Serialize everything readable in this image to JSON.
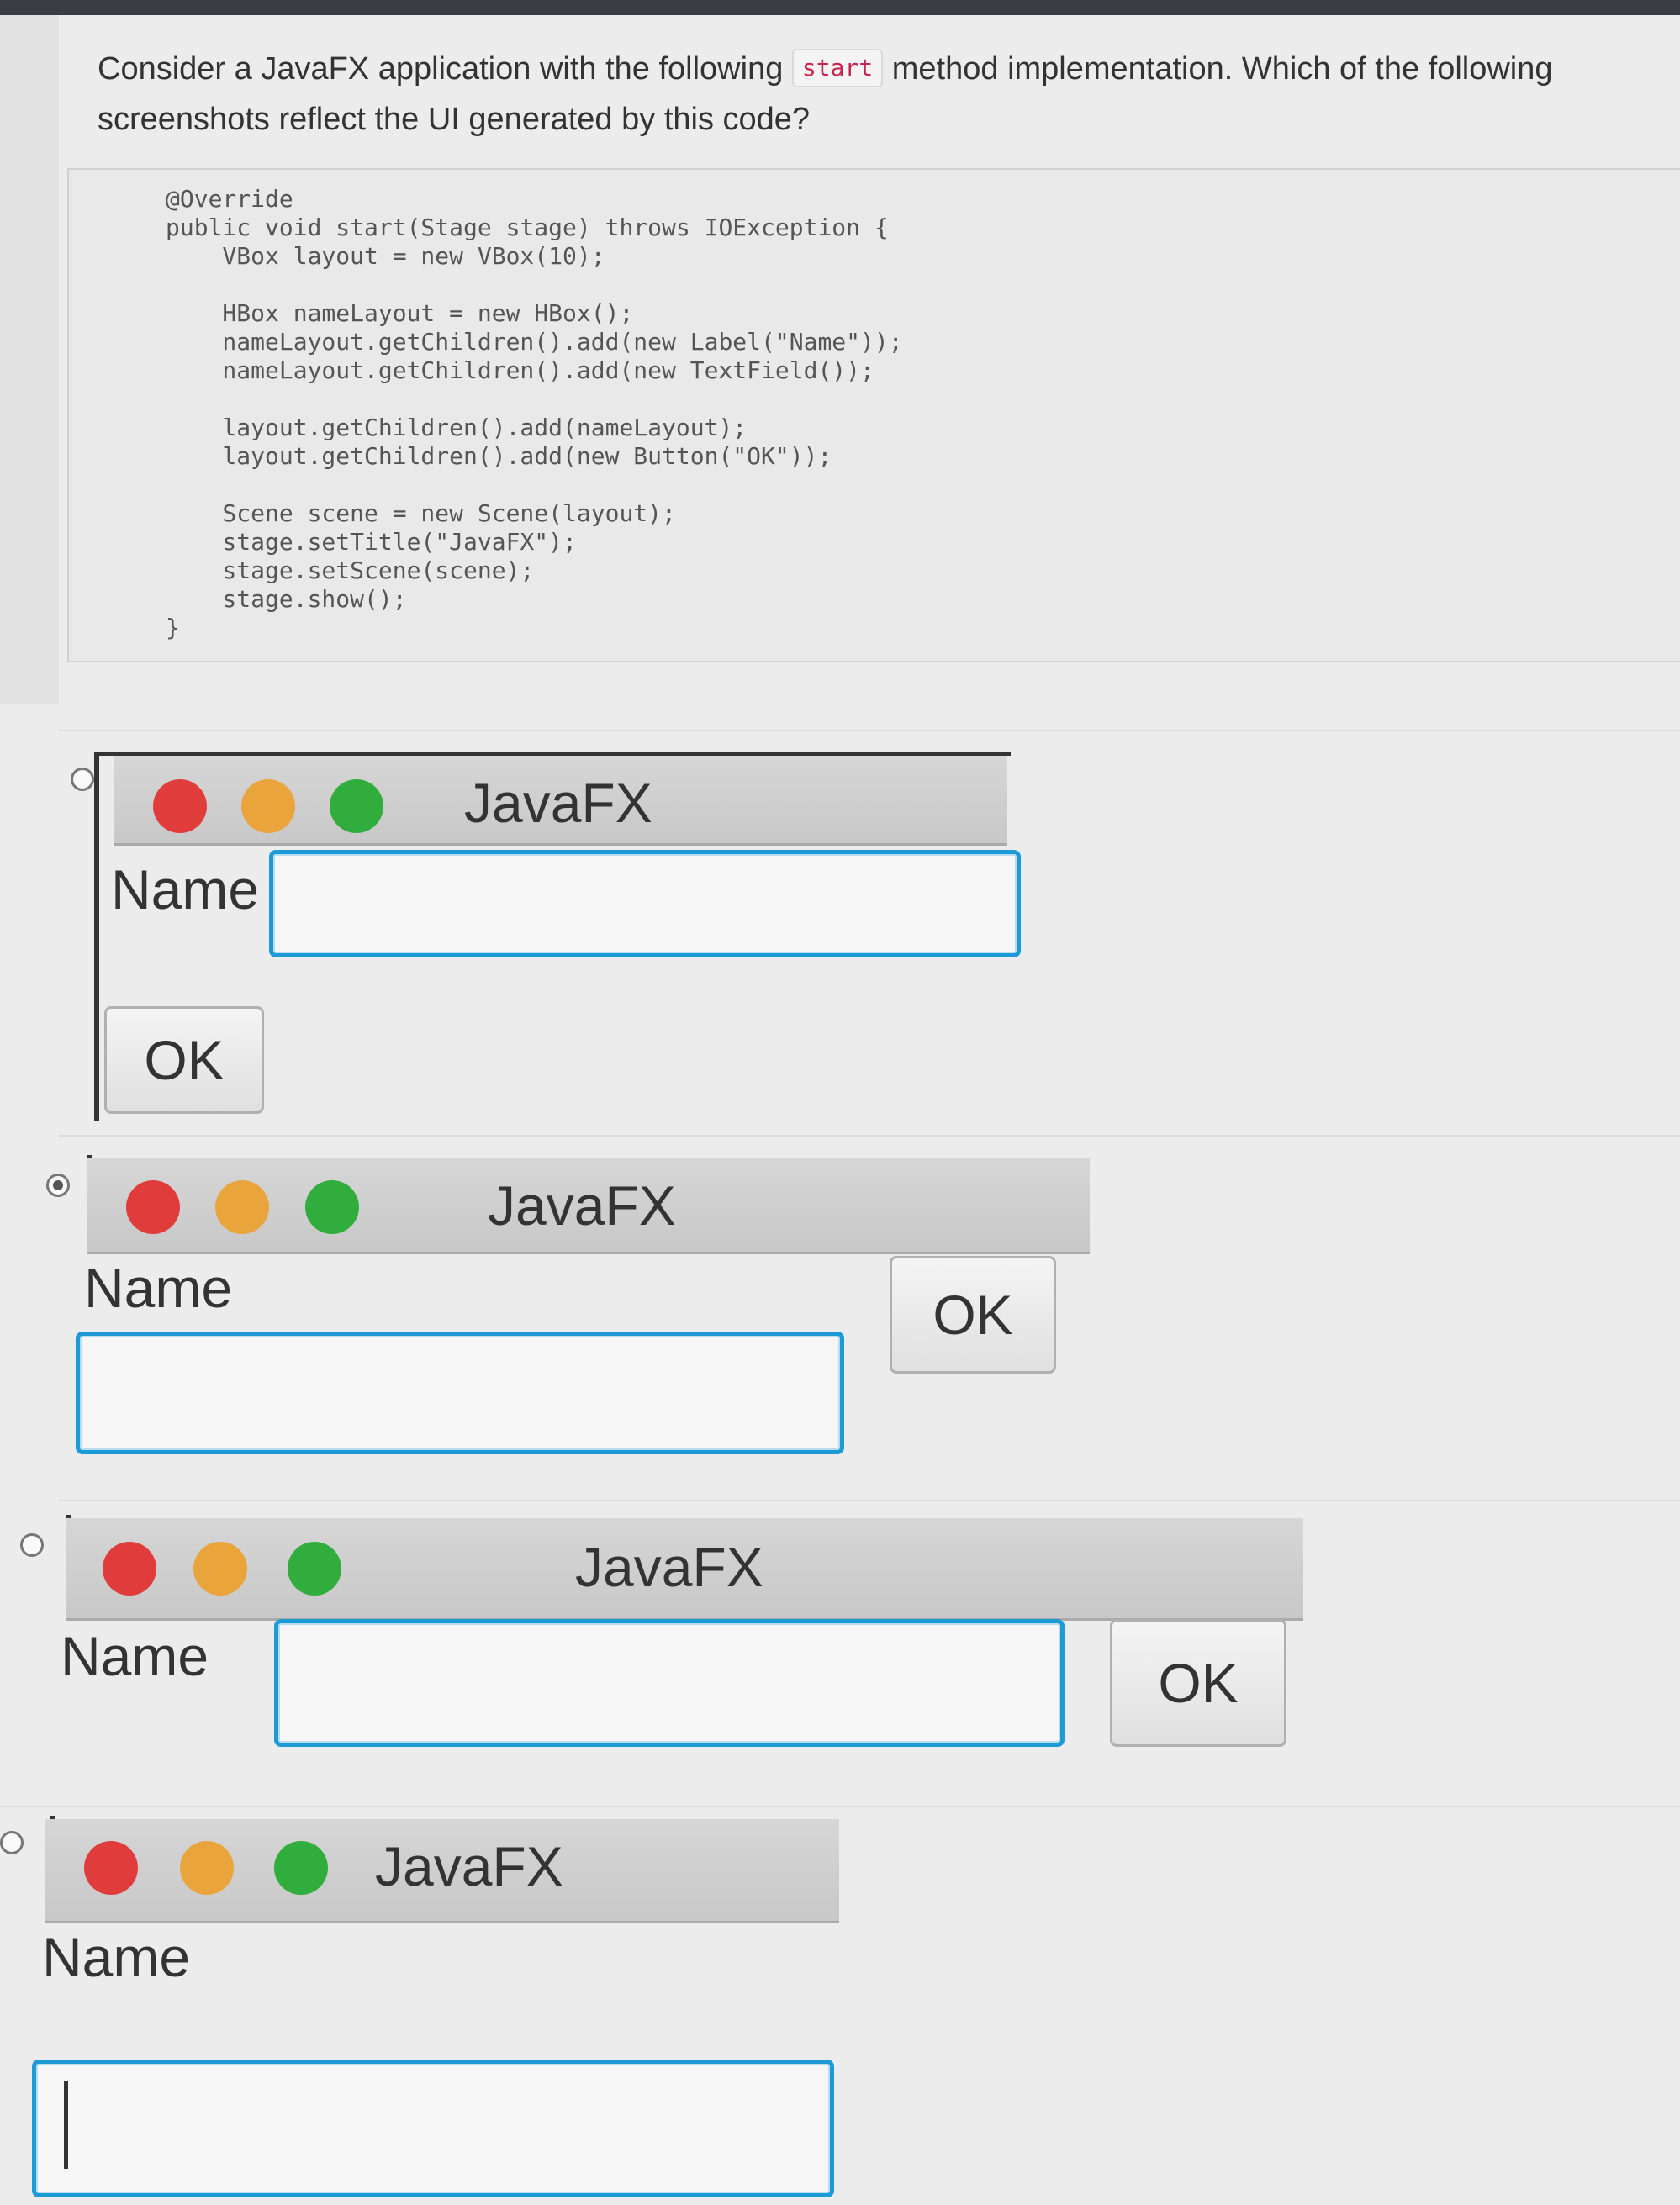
{
  "question": {
    "text_before": "Consider a JavaFX application with the following",
    "inline_code": "start",
    "text_after": "method implementation. Which of the following screenshots reflect the UI generated by this code?"
  },
  "code": "@Override\npublic void start(Stage stage) throws IOException {\n    VBox layout = new VBox(10);\n\n    HBox nameLayout = new HBox();\n    nameLayout.getChildren().add(new Label(\"Name\"));\n    nameLayout.getChildren().add(new TextField());\n\n    layout.getChildren().add(nameLayout);\n    layout.getChildren().add(new Button(\"OK\"));\n\n    Scene scene = new Scene(layout);\n    stage.setTitle(\"JavaFX\");\n    stage.setScene(scene);\n    stage.show();\n}",
  "options": [
    {
      "window_title": "JavaFX",
      "label": "Name",
      "button": "OK",
      "selected": false
    },
    {
      "window_title": "JavaFX",
      "label": "Name",
      "button": "OK",
      "selected": true
    },
    {
      "window_title": "JavaFX",
      "label": "Name",
      "button": "OK",
      "selected": false
    },
    {
      "window_title": "JavaFX",
      "label": "Name",
      "selected": false
    }
  ],
  "colors": {
    "close": "#e03c3c",
    "minimize": "#e9a43c",
    "maximize": "#30ad3c",
    "focus_border": "#1d9bd6"
  }
}
